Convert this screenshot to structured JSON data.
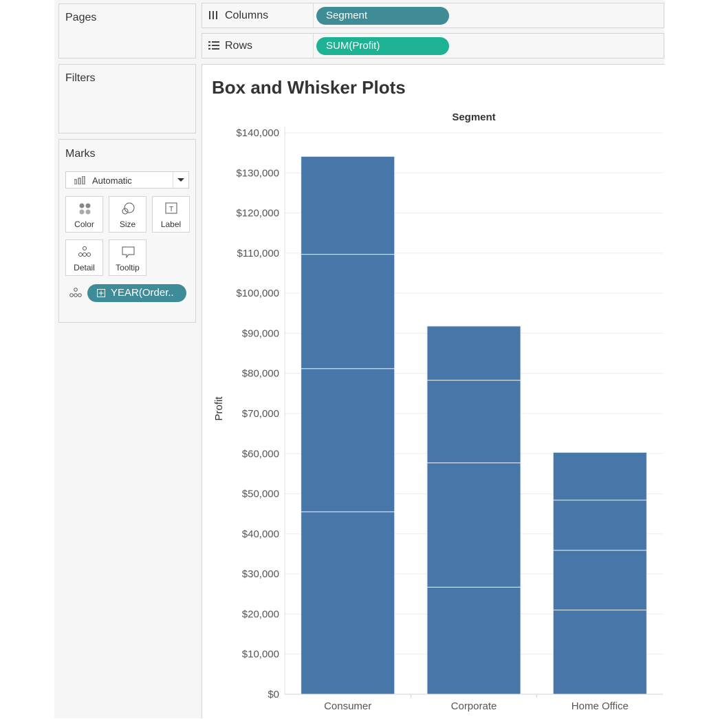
{
  "left_panel": {
    "pages_label": "Pages",
    "filters_label": "Filters",
    "marks": {
      "label": "Marks",
      "mark_type": "Automatic",
      "buttons": [
        {
          "label": "Color",
          "icon": "color-icon"
        },
        {
          "label": "Size",
          "icon": "size-icon"
        },
        {
          "label": "Label",
          "icon": "label-icon"
        },
        {
          "label": "Detail",
          "icon": "detail-icon"
        },
        {
          "label": "Tooltip",
          "icon": "tooltip-icon"
        }
      ],
      "detail_pill": "YEAR(Order.."
    }
  },
  "shelves": {
    "columns_label": "Columns",
    "columns_pill": "Segment",
    "rows_label": "Rows",
    "rows_pill": "SUM(Profit)"
  },
  "colors": {
    "bar": "#4677a8",
    "columns_pill": "#3f8c96",
    "rows_pill": "#1eb294",
    "detail_pill": "#3d8c97"
  },
  "chart_data": {
    "type": "bar",
    "title": "Box and Whisker Plots",
    "column_header": "Segment",
    "ylabel": "Profit",
    "categories": [
      "Consumer",
      "Corporate",
      "Home Office"
    ],
    "stacked_boundaries": [
      [
        45500,
        81200,
        109700,
        134100
      ],
      [
        26700,
        57700,
        78300,
        91800
      ],
      [
        21000,
        35900,
        48400,
        60300
      ]
    ],
    "ylim": [
      0,
      140000
    ],
    "yticks": [
      "$0",
      "$10,000",
      "$20,000",
      "$30,000",
      "$40,000",
      "$50,000",
      "$60,000",
      "$70,000",
      "$80,000",
      "$90,000",
      "$100,000",
      "$110,000",
      "$120,000",
      "$130,000",
      "$140,000"
    ],
    "grid": true
  }
}
